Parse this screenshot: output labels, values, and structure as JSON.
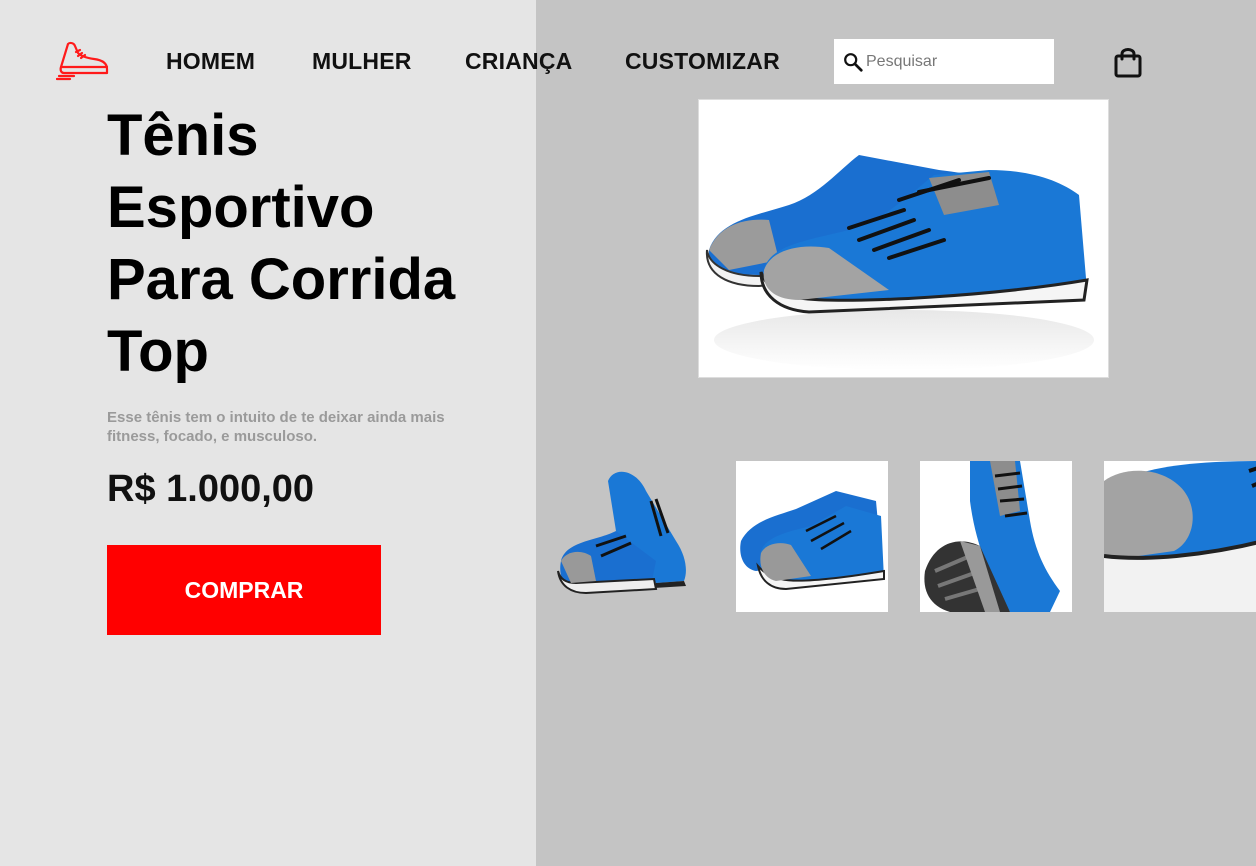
{
  "nav": {
    "items": [
      {
        "label": "HOMEM"
      },
      {
        "label": "MULHER"
      },
      {
        "label": "CRIANÇA"
      },
      {
        "label": "CUSTOMIZAR"
      }
    ]
  },
  "search": {
    "placeholder": "Pesquisar"
  },
  "product": {
    "title": "Tênis Esportivo Para Corrida Top",
    "description": "Esse tênis tem o intuito de te deixar ainda mais fitness, focado, e musculoso.",
    "price": "R$ 1.000,00",
    "buy_label": "COMPRAR"
  },
  "icons": {
    "logo": "running-shoe-icon",
    "search": "search-icon",
    "cart": "shopping-bag-icon"
  },
  "colors": {
    "accent": "#ff0000",
    "left_bg": "#e5e5e5",
    "right_bg": "#c4c4c4",
    "shoe_blue": "#1a78d6"
  }
}
